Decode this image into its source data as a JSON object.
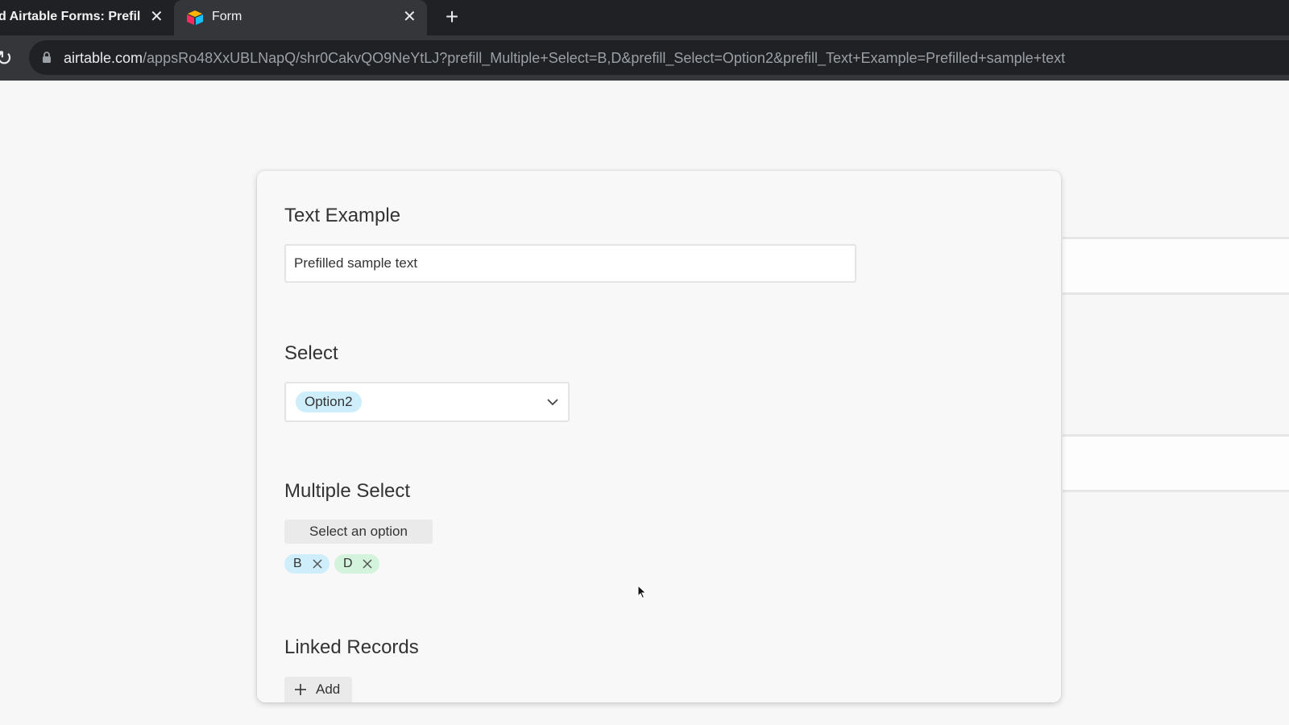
{
  "browser": {
    "tabs": [
      {
        "title": "d Airtable Forms: Prefill",
        "close_icon": "close-icon"
      },
      {
        "title": "Form",
        "favicon": "airtable-logo-icon",
        "close_icon": "close-icon"
      }
    ],
    "new_tab_icon": "plus-icon",
    "reload_icon": "reload-icon",
    "lock_icon": "lock-icon",
    "url_host": "airtable.com",
    "url_path": "/appsRo48XxUBLNapQ/shr0CakvQO9NeYtLJ?prefill_Multiple+Select=B,D&prefill_Select=Option2&prefill_Text+Example=Prefilled+sample+text"
  },
  "form": {
    "text_example": {
      "label": "Text Example",
      "value": "Prefilled sample text"
    },
    "select": {
      "label": "Select",
      "selected": "Option2",
      "chevron_icon": "chevron-down-icon",
      "pill_color": "#cfeefb"
    },
    "multiple_select": {
      "label": "Multiple Select",
      "button_label": "Select an option",
      "tags": [
        {
          "label": "B",
          "color": "#cfeefb",
          "remove_icon": "close-icon"
        },
        {
          "label": "D",
          "color": "#d4f3dc",
          "remove_icon": "close-icon"
        }
      ]
    },
    "linked_records": {
      "label": "Linked Records",
      "add_label": "Add",
      "add_icon": "plus-icon"
    }
  },
  "colors": {
    "chrome_dark": "#202124",
    "chrome_tab": "#35363a",
    "page_bg": "#f7f7f7",
    "card_bg": "#f8f8f8",
    "button_bg": "#eaeaea"
  }
}
